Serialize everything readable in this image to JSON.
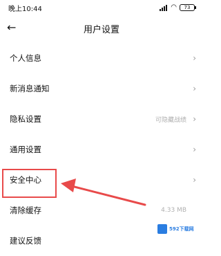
{
  "status_bar": {
    "time": "晚上10:44",
    "battery": "73"
  },
  "header": {
    "back_icon": "←",
    "title": "用户设置"
  },
  "rows": [
    {
      "label": "个人信息",
      "value": "",
      "chevron": "›"
    },
    {
      "label": "新消息通知",
      "value": "",
      "chevron": "›"
    },
    {
      "label": "隐私设置",
      "value": "可隐藏战绩",
      "chevron": "›"
    },
    {
      "label": "通用设置",
      "value": "",
      "chevron": "›"
    },
    {
      "label": "安全中心",
      "value": "",
      "chevron": "›"
    },
    {
      "label": "清除缓存",
      "value": "4.33 MB",
      "chevron": ""
    },
    {
      "label": "建议反馈",
      "value": "",
      "chevron": ""
    }
  ],
  "annotation": {
    "highlight_color": "#e84a4a",
    "target": "安全中心"
  },
  "watermark": {
    "text": "592下载网"
  }
}
